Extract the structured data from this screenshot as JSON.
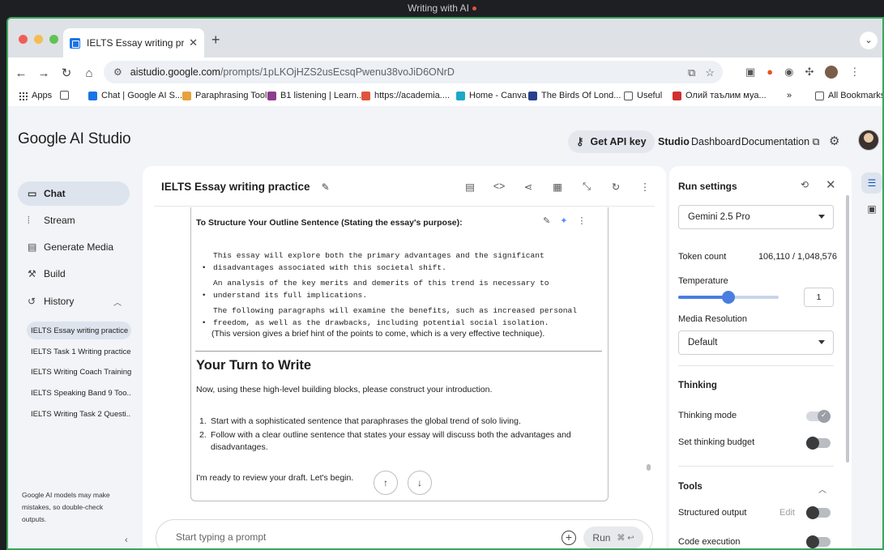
{
  "os": {
    "title": "Writing with AI"
  },
  "browser": {
    "tab_title": "IELTS Essay writing practice |",
    "url_host": "aistudio.google.com",
    "url_path": "/prompts/1pLKOjHZS2usEcsqPwenu38voJiD6ONrD",
    "bookmarks": [
      {
        "label": "Apps",
        "icon": "apps-icon"
      },
      {
        "label": "",
        "icon": "grid-icon"
      },
      {
        "label": "Chat | Google AI S...",
        "icon": "chat-favicon"
      },
      {
        "label": "Paraphrasing Tool",
        "icon": "paraphrase-favicon"
      },
      {
        "label": "B1 listening | Learn...",
        "icon": "b1-favicon"
      },
      {
        "label": "https://academia....",
        "icon": "academia-favicon"
      },
      {
        "label": "Home - Canva",
        "icon": "canva-favicon"
      },
      {
        "label": "The Birds Of Lond...",
        "icon": "birds-favicon"
      },
      {
        "label": "Useful",
        "icon": "folder-icon"
      },
      {
        "label": "Олий таълим муа...",
        "icon": "oliy-favicon"
      }
    ],
    "all_bookmarks": "All Bookmarks",
    "more_bookmarks": "»"
  },
  "app": {
    "brand": "Google AI Studio",
    "get_api_key": "Get API key",
    "nav_links": [
      "Studio",
      "Dashboard",
      "Documentation"
    ],
    "sidebar": {
      "items": [
        {
          "label": "Chat",
          "icon": "chat-icon"
        },
        {
          "label": "Stream",
          "icon": "waveform-icon"
        },
        {
          "label": "Generate Media",
          "icon": "media-icon"
        },
        {
          "label": "Build",
          "icon": "build-icon"
        },
        {
          "label": "History",
          "icon": "history-icon"
        }
      ],
      "history": [
        "IELTS Essay writing practice",
        "IELTS Task 1 Writing practice",
        "IELTS Writing Coach Training",
        "IELTS Speaking Band 9 Too...",
        "IELTS Writing Task 2 Questi..."
      ],
      "disclaimer": "Google AI models may make mistakes, so double-check outputs."
    },
    "chat": {
      "title": "IELTS Essay writing practice",
      "message": {
        "heading": "To Structure Your Outline Sentence (Stating the essay's purpose):",
        "code_bullets": [
          [
            "This essay will explore both the primary advantages and the significant",
            "disadvantages associated with this societal shift."
          ],
          [
            "An analysis of the key merits and demerits of this trend is necessary to",
            "understand its full implications."
          ],
          [
            "The following paragraphs will examine the benefits, such as increased personal",
            "freedom, as well as the drawbacks, including potential social isolation."
          ]
        ],
        "note": "(This version gives a brief hint of the points to come, which is a very effective technique).",
        "section_title": "Your Turn to Write",
        "intro": "Now, using these high-level building blocks, please construct your introduction.",
        "steps": [
          "Start with a sophisticated sentence that paraphrases the global trend of solo living.",
          "Follow with a clear outline sentence that states your essay will discuss both the advantages and disadvantages."
        ],
        "closing": "I'm ready to review your draft. Let's begin."
      },
      "prompt_placeholder": "Start typing a prompt",
      "run_label": "Run",
      "run_shortcut": "⌘ ↩"
    },
    "run_settings": {
      "title": "Run settings",
      "model": "Gemini 2.5 Pro",
      "token_count_label": "Token count",
      "token_count_value": "106,110 / 1,048,576",
      "temperature_label": "Temperature",
      "temperature_value": "1",
      "temperature_fraction": 0.5,
      "media_resolution_label": "Media Resolution",
      "media_resolution_value": "Default",
      "thinking_section": "Thinking",
      "thinking_mode_label": "Thinking mode",
      "thinking_mode_on": true,
      "thinking_budget_label": "Set thinking budget",
      "thinking_budget_on": false,
      "tools_section": "Tools",
      "structured_output_label": "Structured output",
      "structured_output_edit": "Edit",
      "structured_output_on": false,
      "code_execution_label": "Code execution",
      "code_execution_on": false
    }
  }
}
